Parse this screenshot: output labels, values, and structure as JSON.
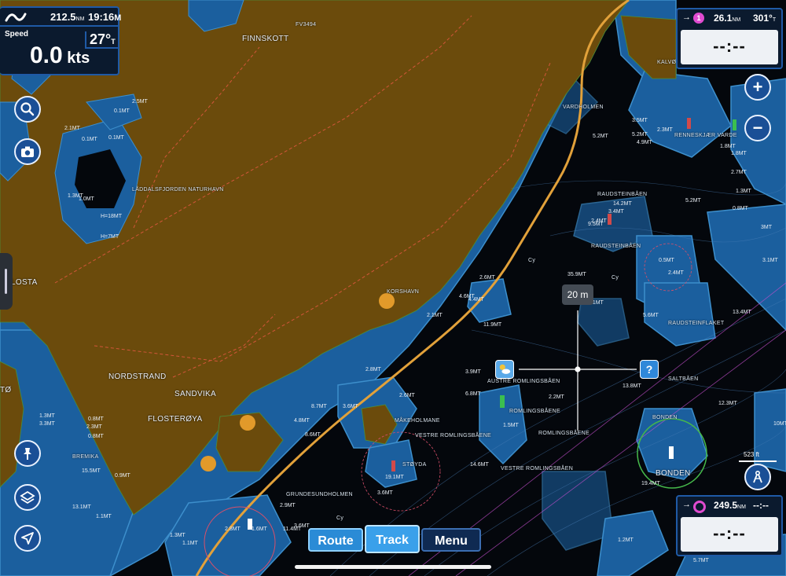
{
  "status": {
    "distance": "212.5",
    "distance_unit": "NM",
    "time": "19:16",
    "time_unit": "M",
    "speed_title": "Speed",
    "speed_value": "0.0",
    "speed_unit": "kts",
    "temperature": "27°",
    "temperature_unit": "T"
  },
  "waypoint_top": {
    "arrow": "→",
    "badge": "1",
    "distance": "26.1",
    "distance_unit": "NM",
    "bearing": "301°",
    "bearing_unit": "T",
    "eta": "--:--"
  },
  "waypoint_bottom": {
    "arrow": "→",
    "distance": "249.5",
    "distance_unit": "NM",
    "bearing": "--:--",
    "eta": "--:--"
  },
  "controls": {
    "zoom_in": "+",
    "zoom_out": "−",
    "cursor_range": "20 m",
    "scale": "523 ft"
  },
  "bottom_bar": {
    "route": "Route",
    "track": "Track",
    "menu": "Menu"
  },
  "icons": {
    "logo": "navionics-logo-icon",
    "search": "search-icon",
    "camera": "camera-icon",
    "pin": "pin-icon",
    "layers": "layers-icon",
    "locate": "location-arrow-icon",
    "compass": "compass-icon",
    "weather": "weather-icon",
    "info": "question-icon"
  },
  "colors": {
    "land": "#6b4b0c",
    "deep_water": "#04070c",
    "shallow_water": "#1a5d9c",
    "shallow_light": "#3d8fcc",
    "track": "#e2a13a",
    "panel_border": "#1f5aa6",
    "waypoint": "#e04bd0"
  },
  "map": {
    "place_labels": [
      "FINNSKOTT",
      "LÅDDALSFJORDEN NATURHAVN",
      "LOSTA",
      "NORDSTRAND",
      "SANDVIKA",
      "FLOSTERØYA",
      "KORSHAVN",
      "MÅKEHOLMANE",
      "VESTRE ROMLINGSBÅENE",
      "ROMLINGSBÅENE",
      "AUSTRE ROMLINGSBÅEN",
      "ROMLINGSBÅENE",
      "VESTRE ROMLINGSBÅEN",
      "STØYDA",
      "GRUNDESUNDHOLMEN",
      "BONDEN",
      "BONDEN",
      "SALTBÅEN",
      "RAUDSTEINFLAKET",
      "RAUDSTEINBÅEN",
      "RAUDSTEINBÅEN",
      "RENNESKJÆR VARDE",
      "KALVØY",
      "VARDHOLMEN",
      "BREMIKA",
      "FV3494",
      "TØ",
      "Cy",
      "Cy",
      "Cy"
    ],
    "depth_labels": [
      "2.5MT",
      "0.1MT",
      "0.1MT",
      "2.1MT",
      "0.1MT",
      "1.3MT",
      "1.0MT",
      "H=18MT",
      "H=7MT",
      "2.1MT",
      "11.9MT",
      "2.8MT",
      "8.7MT",
      "3.6MT",
      "4.8MT",
      "8.6MT",
      "2.6MT",
      "4.6MT",
      "19.1MT",
      "3.6MT",
      "6.8MT",
      "3.9MT",
      "14.6MT",
      "2.2MT",
      "1.5MT",
      "13.8MT",
      "12.3MT",
      "19.4MT",
      "10MT",
      "13.4MT",
      "5.2MT",
      "3.1MT",
      "5.6MT",
      "6.1MT",
      "14.2MT",
      "1.8MT",
      "0.5MT",
      "3.4MT",
      "2.4MT",
      "5.2MT",
      "4.9MT",
      "2.3MT",
      "3.5MT",
      "5.2MT",
      "3MT",
      "1.3MT",
      "1.1MT",
      "1.2MT",
      "5.7MT",
      "2.9MT",
      "3.6MT",
      "11.4MT",
      "2.8MT",
      "1.6MT",
      "1.3MT",
      "0.8MT",
      "2.3MT",
      "3.3MT",
      "0.8MT",
      "0.9MT",
      "15.5MT",
      "13.1MT",
      "1.1MT",
      "4.4MT",
      "35.9MT",
      "2.6MT",
      "1.8MT",
      "2.7MT",
      "1.3MT",
      "0.8MT",
      "9.5MT",
      "2.4MT"
    ]
  }
}
